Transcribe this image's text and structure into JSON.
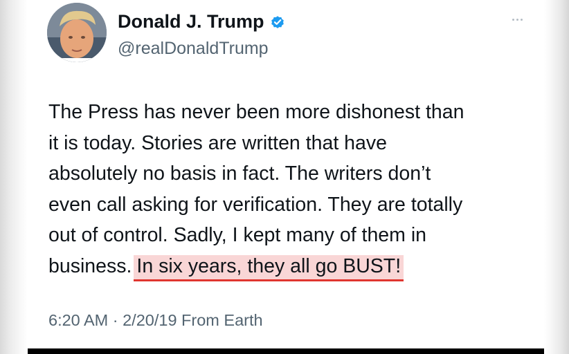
{
  "tweet": {
    "author_name": "Donald J. Trump",
    "handle": "@realDonaldTrump",
    "verified": true,
    "verified_icon": "verified-badge-icon",
    "more_icon": "more-options-icon",
    "body_lines": [
      "The Press has never been more dishonest than",
      "it is today. Stories are written that have",
      "absolutely no basis in fact. The writers don’t",
      "even call asking for verification. They are totally",
      "out of control. Sadly, I kept many of them in",
      "business."
    ],
    "highlighted_text": "In six years, they all go BUST!",
    "meta": "6:20 AM · 2/20/19 From Earth"
  },
  "colors": {
    "text_primary": "#0f1419",
    "text_secondary": "#536471",
    "verified_blue": "#1d9bf0",
    "highlight_bg": "#f9d6d6",
    "highlight_underline": "#e0362f"
  }
}
